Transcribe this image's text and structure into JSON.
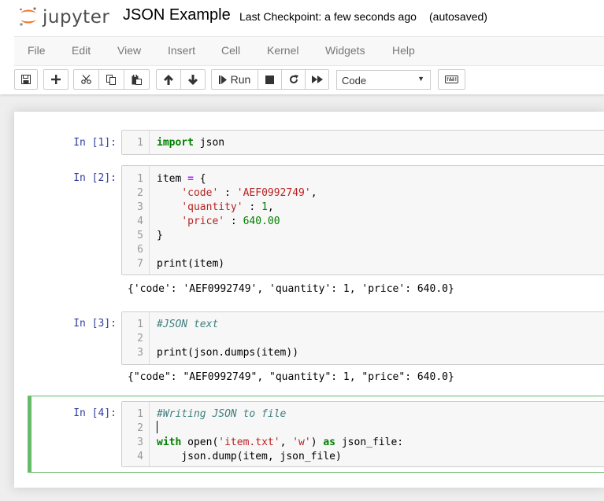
{
  "header": {
    "logo_text": "jupyter",
    "notebook_name": "JSON Example",
    "checkpoint": "Last Checkpoint: a few seconds ago",
    "autosave": "(autosaved)"
  },
  "menu": [
    "File",
    "Edit",
    "View",
    "Insert",
    "Cell",
    "Kernel",
    "Widgets",
    "Help"
  ],
  "toolbar": {
    "run_label": "Run",
    "cell_type": "Code",
    "icons": [
      "save-icon",
      "plus-icon",
      "cut-icon",
      "copy-icon",
      "paste-icon",
      "arrow-up-icon",
      "arrow-down-icon",
      "step-forward-icon",
      "stop-icon",
      "refresh-icon",
      "fast-forward-icon",
      "keyboard-icon"
    ]
  },
  "cells": [
    {
      "prompt": "In [1]:",
      "lines": [
        {
          "n": "1",
          "parts": [
            {
              "t": "import",
              "c": "kw"
            },
            {
              "t": " json",
              "c": ""
            }
          ]
        }
      ],
      "output": ""
    },
    {
      "prompt": "In [2]:",
      "lines": [
        {
          "n": "1",
          "parts": [
            {
              "t": "item ",
              "c": ""
            },
            {
              "t": "=",
              "c": "op"
            },
            {
              "t": " {",
              "c": ""
            }
          ]
        },
        {
          "n": "2",
          "parts": [
            {
              "t": "    ",
              "c": ""
            },
            {
              "t": "'code'",
              "c": "str"
            },
            {
              "t": " : ",
              "c": ""
            },
            {
              "t": "'AEF0992749'",
              "c": "str"
            },
            {
              "t": ",",
              "c": ""
            }
          ]
        },
        {
          "n": "3",
          "parts": [
            {
              "t": "    ",
              "c": ""
            },
            {
              "t": "'quantity'",
              "c": "str"
            },
            {
              "t": " : ",
              "c": ""
            },
            {
              "t": "1",
              "c": "num"
            },
            {
              "t": ",",
              "c": ""
            }
          ]
        },
        {
          "n": "4",
          "parts": [
            {
              "t": "    ",
              "c": ""
            },
            {
              "t": "'price'",
              "c": "str"
            },
            {
              "t": " : ",
              "c": ""
            },
            {
              "t": "640.00",
              "c": "num"
            }
          ]
        },
        {
          "n": "5",
          "parts": [
            {
              "t": "}",
              "c": ""
            }
          ]
        },
        {
          "n": "6",
          "parts": []
        },
        {
          "n": "7",
          "parts": [
            {
              "t": "print",
              "c": ""
            },
            {
              "t": "(item)",
              "c": ""
            }
          ]
        }
      ],
      "output": "{'code': 'AEF0992749', 'quantity': 1, 'price': 640.0}"
    },
    {
      "prompt": "In [3]:",
      "lines": [
        {
          "n": "1",
          "parts": [
            {
              "t": "#JSON text",
              "c": "cm"
            }
          ]
        },
        {
          "n": "2",
          "parts": []
        },
        {
          "n": "3",
          "parts": [
            {
              "t": "print",
              "c": ""
            },
            {
              "t": "(json.dumps(item))",
              "c": ""
            }
          ]
        }
      ],
      "output": "{\"code\": \"AEF0992749\", \"quantity\": 1, \"price\": 640.0}"
    },
    {
      "prompt": "In [4]:",
      "lines": [
        {
          "n": "1",
          "parts": [
            {
              "t": "#Writing JSON to file",
              "c": "cm"
            }
          ]
        },
        {
          "n": "2",
          "parts": []
        },
        {
          "n": "3",
          "parts": [
            {
              "t": "with",
              "c": "kw"
            },
            {
              "t": " open(",
              "c": ""
            },
            {
              "t": "'item.txt'",
              "c": "str"
            },
            {
              "t": ", ",
              "c": ""
            },
            {
              "t": "'w'",
              "c": "str"
            },
            {
              "t": ") ",
              "c": ""
            },
            {
              "t": "as",
              "c": "kw"
            },
            {
              "t": " json_file:",
              "c": ""
            }
          ]
        },
        {
          "n": "4",
          "parts": [
            {
              "t": "    json.dump(item, json_file)",
              "c": ""
            }
          ]
        }
      ],
      "output": ""
    }
  ]
}
